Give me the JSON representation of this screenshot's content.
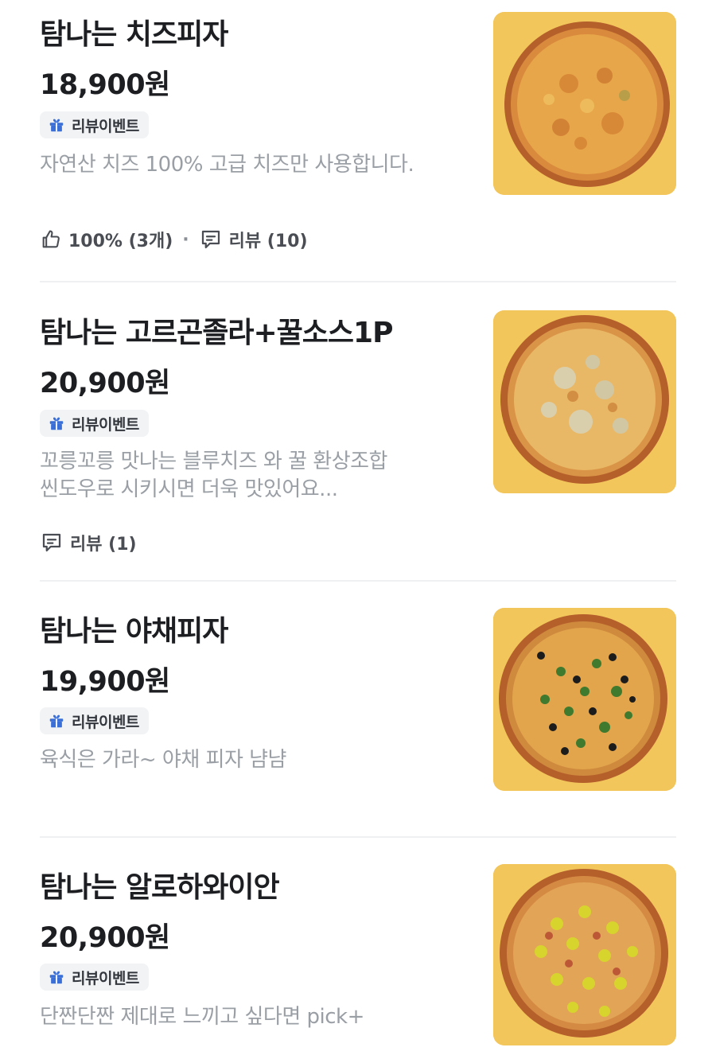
{
  "menu": {
    "items": [
      {
        "name": "탐나는 치즈피자",
        "price": "18,900원",
        "badge": "리뷰이벤트",
        "description": [
          "자연산 치즈 100%  고급 치즈만 사용합니다."
        ],
        "rating": "100% (3개)",
        "reviews": "리뷰 (10)",
        "pizza_type": "cheese"
      },
      {
        "name": "탐나는 고르곤졸라+꿀소스1P",
        "price": "20,900원",
        "badge": "리뷰이벤트",
        "description": [
          "꼬릉꼬릉 맛나는 블루치즈 와 꿀 환상조합",
          "씬도우로 시키시면 더욱 맛있어요..."
        ],
        "reviews": "리뷰 (1)",
        "pizza_type": "gorgonzola"
      },
      {
        "name": "탐나는 야채피자",
        "price": "19,900원",
        "badge": "리뷰이벤트",
        "description": [
          "육식은 가라~ 야채 피자 냠냠"
        ],
        "pizza_type": "vegetable"
      },
      {
        "name": "탐나는 알로하와이안",
        "price": "20,900원",
        "badge": "리뷰이벤트",
        "description": [
          "단짠단짠 제대로 느끼고 싶다면 pick+"
        ],
        "pizza_type": "hawaiian"
      }
    ]
  },
  "icons": {
    "badge": "gift-icon",
    "rating": "thumbs-up-icon",
    "reviews": "comment-icon"
  },
  "colors": {
    "thumbnail_background": "#f3c65c",
    "gift_icon": "#3b6fd8",
    "description_text": "#9a9fa6",
    "badge_background": "#f1f3f5"
  }
}
